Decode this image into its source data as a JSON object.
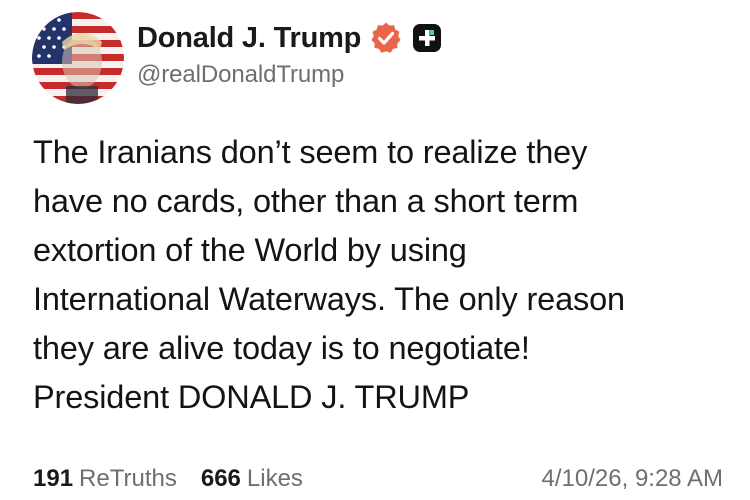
{
  "author": {
    "display_name": "Donald J. Trump",
    "handle": "@realDonaldTrump",
    "avatar_icon": "flag-portrait-avatar",
    "verified_icon": "verified-badge-icon",
    "verified_color": "#e8664a",
    "plus_icon": "plus-badge-icon"
  },
  "post": {
    "lines": [
      "The Iranians don’t seem to realize they",
      "have no cards, other than a short term",
      "extortion of the World by using",
      "International Waterways. The only reason",
      "they are alive today is to negotiate!",
      "President DONALD J. TRUMP"
    ]
  },
  "stats": {
    "retruths_count": "191",
    "retruths_label": "ReTruths",
    "likes_count": "666",
    "likes_label": "Likes",
    "timestamp": "4/10/26, 9:28 AM"
  }
}
